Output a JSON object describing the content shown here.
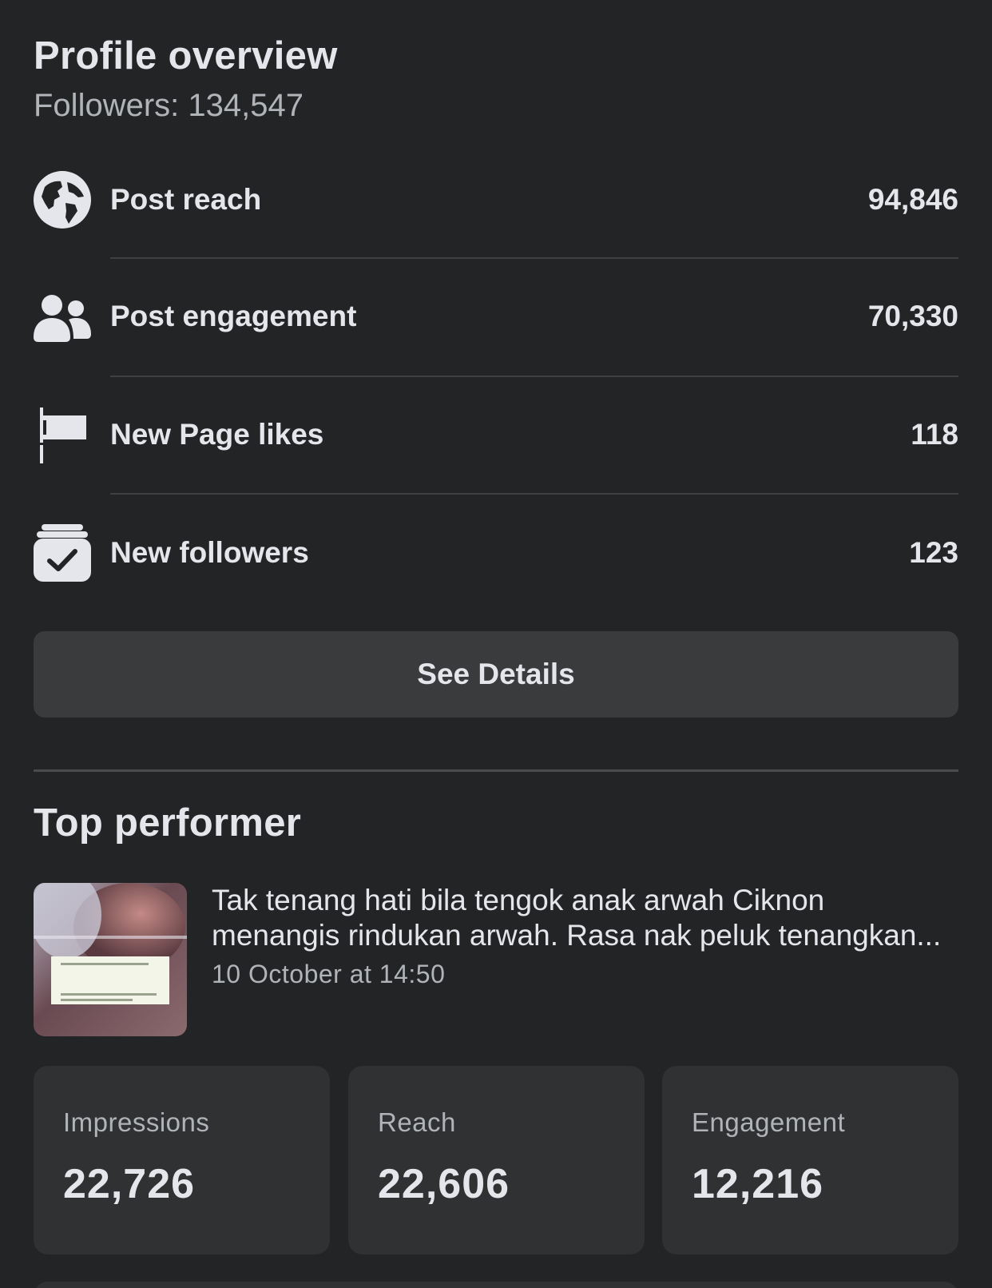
{
  "profile_overview": {
    "title": "Profile overview",
    "followers_text": "Followers: 134,547",
    "metrics": [
      {
        "icon": "globe-icon",
        "label": "Post reach",
        "value": "94,846"
      },
      {
        "icon": "people-icon",
        "label": "Post engagement",
        "value": "70,330"
      },
      {
        "icon": "flag-icon",
        "label": "New Page likes",
        "value": "118"
      },
      {
        "icon": "follow-check-icon",
        "label": "New followers",
        "value": "123"
      }
    ],
    "details_button_label": "See Details"
  },
  "top_performer": {
    "title": "Top performer",
    "post": {
      "text": "Tak tenang hati bila tengok anak arwah Ciknon menangis rindukan arwah. Rasa nak peluk tenangkan...",
      "date": "10 October at 14:50"
    },
    "stats": [
      {
        "label": "Impressions",
        "value": "22,726"
      },
      {
        "label": "Reach",
        "value": "22,606"
      },
      {
        "label": "Engagement",
        "value": "12,216"
      }
    ]
  },
  "colors": {
    "background": "#232426",
    "card": "#303133",
    "button": "#3a3b3d",
    "primary_text": "#e4e6eb",
    "secondary_text": "#b0b3b8"
  }
}
